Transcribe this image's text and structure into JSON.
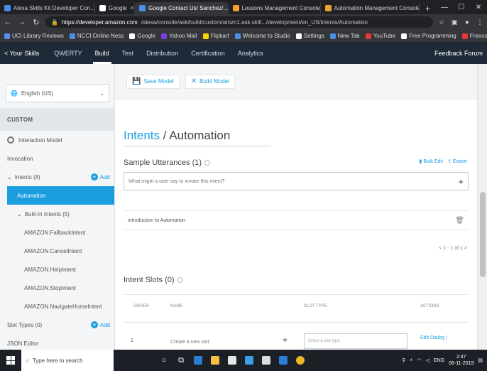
{
  "browser": {
    "tabs": [
      {
        "label": "Alexa Skills Kit Developer Con...",
        "color": "#4a8fe7",
        "active": false
      },
      {
        "label": "Google",
        "color": "#ffffff",
        "active": false
      },
      {
        "label": "Google Contact Us/ Sanchez/...",
        "color": "#4a8fe7",
        "active": true
      },
      {
        "label": "Lessons Management Console",
        "color": "#f0a030",
        "active": false
      },
      {
        "label": "Automation Management Console",
        "color": "#f0a030",
        "active": false
      }
    ],
    "new_tab": "+",
    "url_host": "https://developer.amazon.com",
    "url_path": "/alexa/console/ask/build/custom/amzn1.ask.skill.../development/en_US/intents/Automation",
    "bookmarks": [
      {
        "label": "UCI Library Reviews",
        "color": "#5b8def"
      },
      {
        "label": "NCCI Online Ness",
        "color": "#4a8fe7"
      },
      {
        "label": "Google",
        "color": "#ffffff"
      },
      {
        "label": "Yahoo Mail",
        "color": "#7b3fe4"
      },
      {
        "label": "Flipkart",
        "color": "#f7d600"
      },
      {
        "label": "Welcome to Studio",
        "color": "#4a8fe7"
      },
      {
        "label": "Settings",
        "color": "#ffffff"
      },
      {
        "label": "New Tab",
        "color": "#4a8fe7"
      },
      {
        "label": "YouTube",
        "color": "#e53935"
      },
      {
        "label": "Free Programming",
        "color": "#ffffff"
      },
      {
        "label": "Freecode Compan.",
        "color": "#e53935"
      }
    ]
  },
  "appnav": {
    "brand": "< Your Skills",
    "items": [
      {
        "label": "QWERTY",
        "active": false
      },
      {
        "label": "Build",
        "active": true
      },
      {
        "label": "Test",
        "active": false
      },
      {
        "label": "Distribution",
        "active": false
      },
      {
        "label": "Certification",
        "active": false
      },
      {
        "label": "Analytics",
        "active": false
      }
    ],
    "right": "Feedback Forum"
  },
  "sidebar": {
    "language": "English (US)",
    "custom_header": "CUSTOM",
    "interaction_model": "Interaction Model",
    "invocation": "Invocation",
    "intents_label": "Intents (8)",
    "add_label": "Add",
    "active_intent": "Automation",
    "builtin_label": "Built-In Intents (5)",
    "builtin_items": [
      "AMAZON.FallbackIntent",
      "AMAZON.CancelIntent",
      "AMAZON.HelpIntent",
      "AMAZON.StopIntent",
      "AMAZON.NavigateHomeIntent"
    ],
    "slot_types_label": "Slot Types (0)",
    "json_editor": "JSON Editor"
  },
  "main": {
    "toolbar": {
      "save_label": "Save Model",
      "build_label": "Build Model"
    },
    "breadcrumb_root": "Intents",
    "separator": " / ",
    "intent_name": "Automation",
    "utterances_title": "Sample Utterances (1)",
    "bulk_edit": "Bulk Edit",
    "export": "Export",
    "utterance_placeholder": "What might a user say to invoke this intent?",
    "utterances": [
      "introduction to Automation"
    ],
    "pager": "< 1 - 1 of 1 >",
    "slots_title": "Intent Slots (0)",
    "slot_columns": {
      "order": "ORDER",
      "name": "NAME",
      "slot_type": "SLOT TYPE",
      "actions": "ACTIONS"
    },
    "slot_row": {
      "num": "1",
      "name_placeholder": "Create a new slot",
      "type_placeholder": "Select a slot type",
      "action": "Edit Dialog |"
    }
  },
  "taskbar": {
    "search": "Type here to search",
    "time": "2:47",
    "date": "06-11-2019",
    "lang": "ENG",
    "icons": [
      {
        "name": "mic-icon",
        "glyph": "🎤"
      },
      {
        "name": "task-view-icon",
        "glyph": "▭"
      },
      {
        "name": "edge-icon",
        "color": "#2b7cd3"
      },
      {
        "name": "file-explorer-icon",
        "color": "#f5c044"
      },
      {
        "name": "store-icon",
        "color": "#ffffff"
      },
      {
        "name": "vscode-icon",
        "color": "#3c9ee6"
      },
      {
        "name": "photos-icon",
        "color": "#ffffff"
      },
      {
        "name": "mail-icon",
        "color": "#2b7cd3"
      },
      {
        "name": "chrome-icon",
        "color": "#e8b923"
      }
    ]
  }
}
